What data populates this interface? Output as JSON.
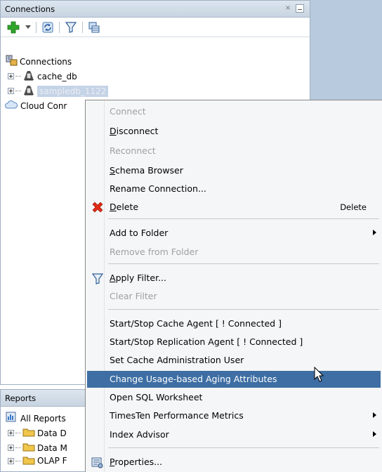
{
  "connections_panel": {
    "title": "Connections",
    "close_glyph": "×",
    "tree": [
      {
        "label": "Connections",
        "icon": "connections-folder-icon"
      },
      {
        "label": "cache_db",
        "icon": "database-icon"
      },
      {
        "label": "sampledb_1122",
        "icon": "database-icon",
        "selected": true
      },
      {
        "label": "Cloud Conr",
        "icon": "cloud-icon"
      }
    ]
  },
  "reports_panel": {
    "title": "Reports",
    "tree": [
      {
        "label": "All Reports",
        "icon": "reports-icon"
      },
      {
        "label": "Data D",
        "icon": "folder-icon"
      },
      {
        "label": "Data M",
        "icon": "folder-icon"
      },
      {
        "label": "OLAP F",
        "icon": "folder-icon"
      }
    ]
  },
  "context_menu": {
    "items": [
      {
        "label": "Connect",
        "mnemonic_index": null,
        "disabled": true
      },
      {
        "label_pre": "D",
        "label_rest": "isconnect"
      },
      {
        "label": "Reconnect",
        "disabled": true
      },
      {
        "label_pre": "S",
        "label_rest": "chema Browser"
      },
      {
        "label": "Rename Connection..."
      },
      {
        "label_pre": "D",
        "label_rest": "elete",
        "accelerator": "Delete",
        "icon": "delete-x-icon"
      },
      {
        "label": "Add to Folder",
        "submenu": true
      },
      {
        "label": "Remove from Folder",
        "disabled": true
      },
      {
        "label_pre": "A",
        "label_rest": "pply Filter...",
        "icon": "filter-icon"
      },
      {
        "label": "Clear Filter",
        "disabled": true
      },
      {
        "label": "Start/Stop Cache Agent [ ! Connected ]"
      },
      {
        "label": "Start/Stop Replication Agent [ ! Connected ]"
      },
      {
        "label": "Set Cache Administration User"
      },
      {
        "label": "Change Usage-based Aging Attributes",
        "highlighted": true
      },
      {
        "label": "Open SQL Worksheet"
      },
      {
        "label": "TimesTen Performance Metrics",
        "submenu": true
      },
      {
        "label": "Index Advisor",
        "submenu": true
      },
      {
        "label_pre": "P",
        "label_rest": "roperties...",
        "icon": "properties-icon"
      }
    ]
  },
  "colors": {
    "highlight": "#3e6ea3",
    "disabled_text": "#a0a0a0",
    "desktop_bg": "#b8cadd"
  }
}
